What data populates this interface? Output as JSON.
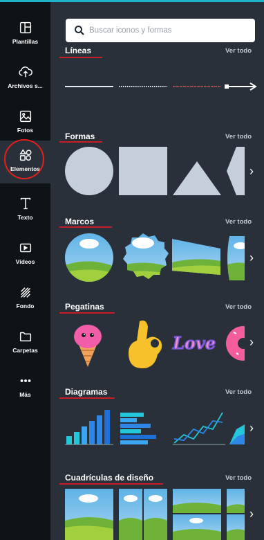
{
  "colors": {
    "accent": "#1fb3c9",
    "underline": "#c91d25",
    "ring": "#e0211c",
    "shape": "#c5cfd9"
  },
  "sidebar": {
    "items": [
      {
        "label": "Plantillas",
        "icon": "templates-icon"
      },
      {
        "label": "Archivos s...",
        "icon": "upload-cloud-icon"
      },
      {
        "label": "Fotos",
        "icon": "photo-icon"
      },
      {
        "label": "Elementos",
        "icon": "elements-icon"
      },
      {
        "label": "Texto",
        "icon": "text-icon"
      },
      {
        "label": "Vídeos",
        "icon": "video-icon"
      },
      {
        "label": "Fondo",
        "icon": "background-icon"
      },
      {
        "label": "Carpetas",
        "icon": "folder-icon"
      },
      {
        "label": "Más",
        "icon": "more-icon"
      }
    ]
  },
  "search": {
    "placeholder": "Buscar iconos y formas"
  },
  "sections": {
    "lineas": {
      "title": "Líneas",
      "see_all": "Ver todo"
    },
    "formas": {
      "title": "Formas",
      "see_all": "Ver todo"
    },
    "marcos": {
      "title": "Marcos",
      "see_all": "Ver todo"
    },
    "pegatinas": {
      "title": "Pegatinas",
      "see_all": "Ver todo"
    },
    "diagramas": {
      "title": "Diagramas",
      "see_all": "Ver todo"
    },
    "cuadriculas": {
      "title": "Cuadrículas de diseño",
      "see_all": "Ver todo"
    }
  },
  "stickers": {
    "love_text": "Love"
  },
  "next_arrow": "›"
}
